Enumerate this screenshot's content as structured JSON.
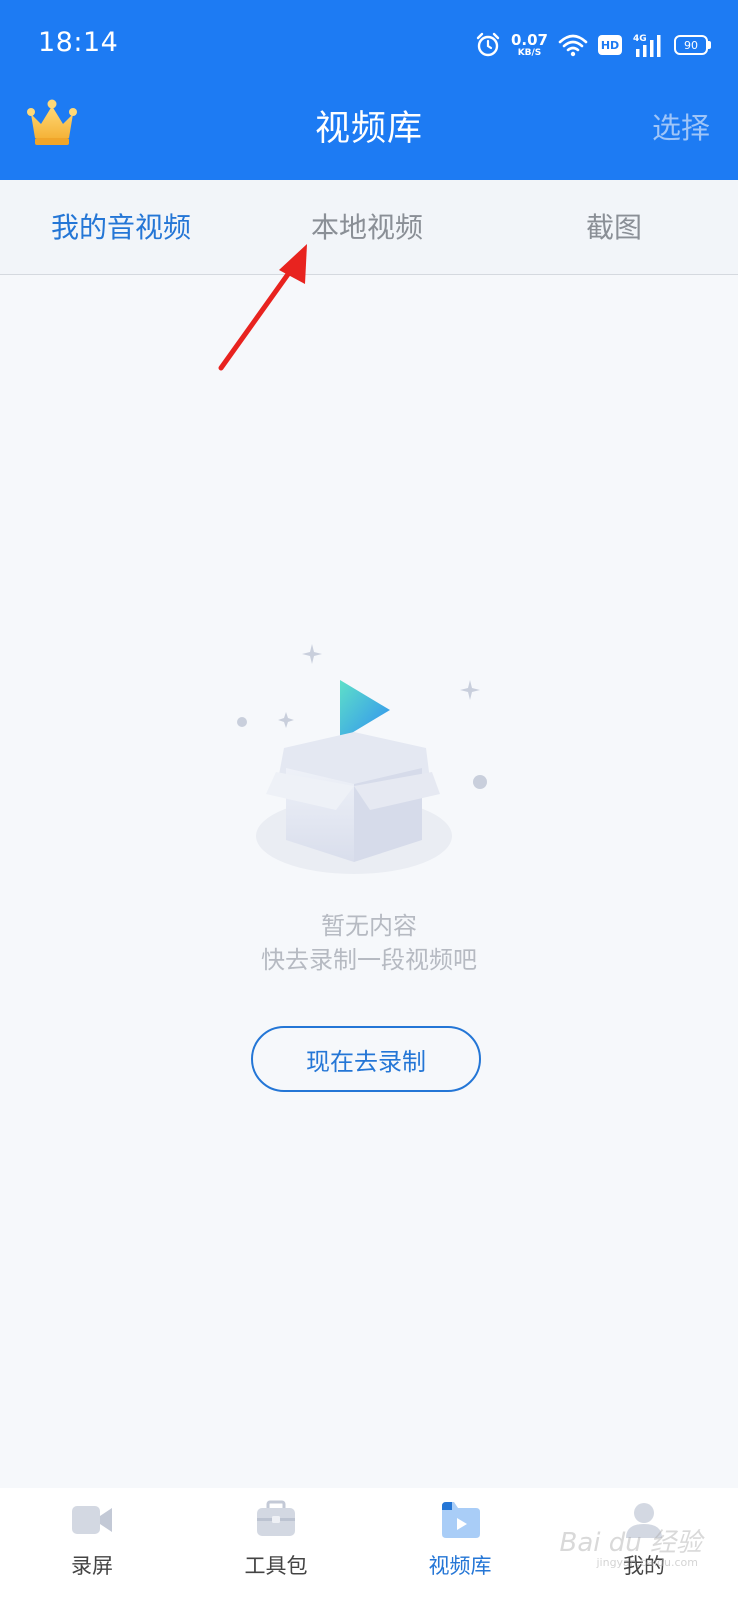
{
  "status_bar": {
    "time": "18:14",
    "net_speed_value": "0.07",
    "net_speed_unit": "KB/S",
    "hd_label": "HD",
    "signal_label": "4G",
    "battery_level": "90"
  },
  "header": {
    "title": "视频库",
    "select_label": "选择"
  },
  "tabs": [
    {
      "label": "我的音视频",
      "active": true
    },
    {
      "label": "本地视频",
      "active": false
    },
    {
      "label": "截图",
      "active": false
    }
  ],
  "empty_state": {
    "title": "暂无内容",
    "subtitle": "快去录制一段视频吧",
    "button_label": "现在去录制"
  },
  "bottom_nav": [
    {
      "label": "录屏",
      "icon": "video-camera-icon",
      "active": false
    },
    {
      "label": "工具包",
      "icon": "toolbox-icon",
      "active": false
    },
    {
      "label": "视频库",
      "icon": "video-folder-icon",
      "active": true
    },
    {
      "label": "我的",
      "icon": "profile-icon",
      "active": false
    }
  ],
  "watermark": {
    "text": "Bai du 经验",
    "sub": "jingyan.baidu.com"
  },
  "colors": {
    "brand_blue": "#1d7bf3",
    "active_blue": "#2476d6",
    "annotation_red": "#e8231f"
  }
}
